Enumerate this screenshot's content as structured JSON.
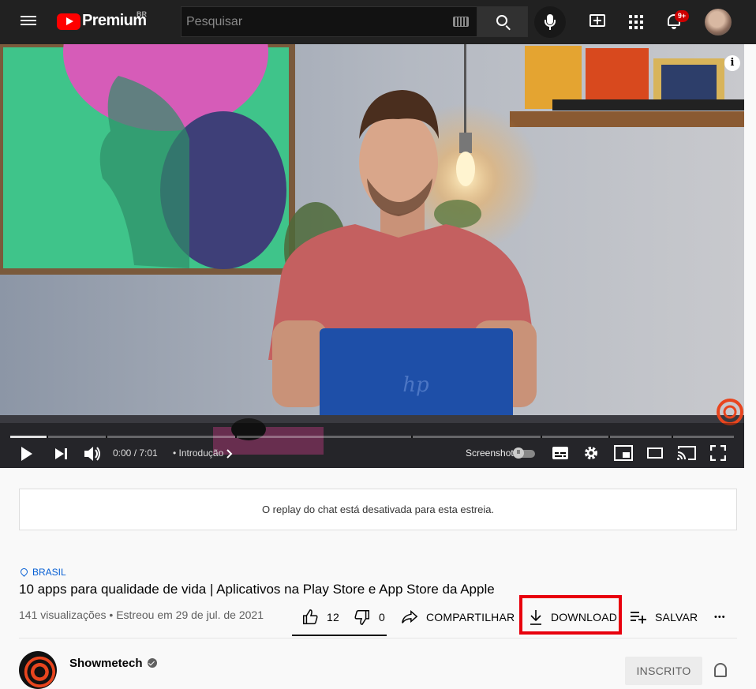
{
  "header": {
    "logo_text": "Premium",
    "country": "BR",
    "search_placeholder": "Pesquisar",
    "notifications_badge": "9+"
  },
  "player": {
    "time": "0:00 / 7:01",
    "chapter": "• Introdução",
    "screenshot_label": "Screenshot",
    "info_symbol": "i"
  },
  "chat": {
    "message": "O replay do chat está desativada para esta estreia."
  },
  "video": {
    "location": "BRASIL",
    "title": "10 apps para qualidade de vida | Aplicativos na Play Store e App Store da Apple",
    "meta": "141 visualizações • Estreou em 29 de jul. de 2021"
  },
  "actions": {
    "likes": "12",
    "dislikes": "0",
    "share": "COMPARTILHAR",
    "download": "DOWNLOAD",
    "save": "SALVAR",
    "more": "•••"
  },
  "channel": {
    "name": "Showmetech",
    "subscribe_label": "INSCRITO"
  },
  "colors": {
    "accent": "#ff0000",
    "highlight_box": "#e8000d",
    "link": "#065fd4"
  }
}
